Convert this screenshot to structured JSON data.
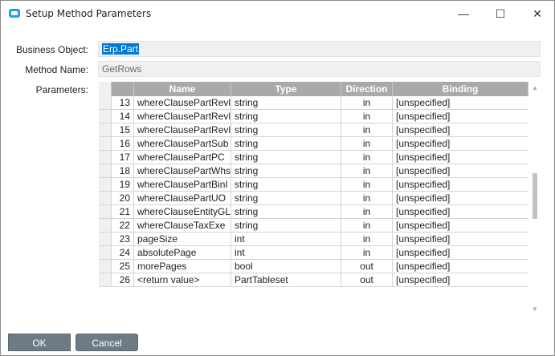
{
  "window": {
    "title": "Setup Method Parameters",
    "minimize": "—",
    "maximize": "☐",
    "close": "✕"
  },
  "form": {
    "business_object_label": "Business Object:",
    "business_object_value": "Erp.Part",
    "method_name_label": "Method Name:",
    "method_name_value": "GetRows",
    "parameters_label": "Parameters:"
  },
  "grid": {
    "columns": [
      "Name",
      "Type",
      "Direction",
      "Binding"
    ],
    "rows": [
      {
        "n": "13",
        "name": "whereClausePartRevl",
        "type": "string",
        "dir": "in",
        "binding": "[unspecified]"
      },
      {
        "n": "14",
        "name": "whereClausePartRevl",
        "type": "string",
        "dir": "in",
        "binding": "[unspecified]"
      },
      {
        "n": "15",
        "name": "whereClausePartRevl",
        "type": "string",
        "dir": "in",
        "binding": "[unspecified]"
      },
      {
        "n": "16",
        "name": "whereClausePartSub",
        "type": "string",
        "dir": "in",
        "binding": "[unspecified]"
      },
      {
        "n": "17",
        "name": "whereClausePartPC",
        "type": "string",
        "dir": "in",
        "binding": "[unspecified]"
      },
      {
        "n": "18",
        "name": "whereClausePartWhs",
        "type": "string",
        "dir": "in",
        "binding": "[unspecified]"
      },
      {
        "n": "19",
        "name": "whereClausePartBinI",
        "type": "string",
        "dir": "in",
        "binding": "[unspecified]"
      },
      {
        "n": "20",
        "name": "whereClausePartUO",
        "type": "string",
        "dir": "in",
        "binding": "[unspecified]"
      },
      {
        "n": "21",
        "name": "whereClauseEntityGL",
        "type": "string",
        "dir": "in",
        "binding": "[unspecified]"
      },
      {
        "n": "22",
        "name": "whereClauseTaxExe",
        "type": "string",
        "dir": "in",
        "binding": "[unspecified]"
      },
      {
        "n": "23",
        "name": "pageSize",
        "type": "int",
        "dir": "in",
        "binding": "[unspecified]"
      },
      {
        "n": "24",
        "name": "absolutePage",
        "type": "int",
        "dir": "in",
        "binding": "[unspecified]"
      },
      {
        "n": "25",
        "name": "morePages",
        "type": "bool",
        "dir": "out",
        "binding": "[unspecified]"
      },
      {
        "n": "26",
        "name": "<return value>",
        "type": "PartTableset",
        "dir": "out",
        "binding": "[unspecified]"
      }
    ]
  },
  "buttons": {
    "ok": "OK",
    "cancel": "Cancel"
  }
}
